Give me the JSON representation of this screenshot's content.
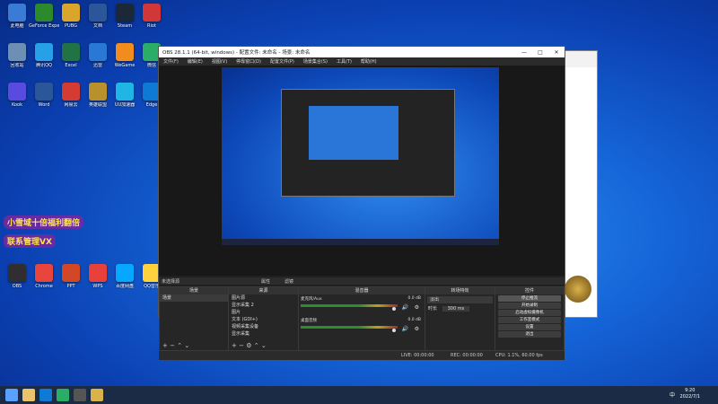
{
  "desktop": {
    "icons": [
      {
        "label": "此电脑",
        "color": "#3a7bd5"
      },
      {
        "label": "GeForce Experience",
        "color": "#2c8a2c"
      },
      {
        "label": "PUBG",
        "color": "#d9a52b"
      },
      {
        "label": "文档",
        "color": "#2b579a"
      },
      {
        "label": "Steam",
        "color": "#1b2838"
      },
      {
        "label": "Riot",
        "color": "#d13639"
      },
      {
        "label": "回收站",
        "color": "#6d8fb3"
      },
      {
        "label": "腾讯QQ",
        "color": "#26a0e6"
      },
      {
        "label": "Excel",
        "color": "#217346"
      },
      {
        "label": "迅雷",
        "color": "#2a78d6"
      },
      {
        "label": "WeGame",
        "color": "#f28c1d"
      },
      {
        "label": "微信",
        "color": "#2aae67"
      },
      {
        "label": "Kook",
        "color": "#5a4be0"
      },
      {
        "label": "Word",
        "color": "#2b579a"
      },
      {
        "label": "网易云",
        "color": "#d43c33"
      },
      {
        "label": "英雄联盟",
        "color": "#b8902c"
      },
      {
        "label": "UU加速器",
        "color": "#1fb5e4"
      },
      {
        "label": "Edge",
        "color": "#0f7ad6"
      },
      {
        "label": "OBS",
        "color": "#302e31"
      },
      {
        "label": "Chrome",
        "color": "#e8453c"
      },
      {
        "label": "PPT",
        "color": "#d24726"
      },
      {
        "label": "WPS",
        "color": "#e8413c"
      },
      {
        "label": "百度网盘",
        "color": "#06a7ff"
      },
      {
        "label": "QQ音乐",
        "color": "#ffd23d"
      }
    ],
    "promo": {
      "line1": "小雪域十倍福利翻倍",
      "line2": "联系管理VX"
    }
  },
  "obs": {
    "title": "OBS 28.1.1 (64-bit, windows) - 配置文件: 未命名 - 场景: 未命名",
    "controls": {
      "minimize": "—",
      "maximize": "□",
      "close": "✕"
    },
    "menu": [
      "文件(F)",
      "编辑(E)",
      "视图(V)",
      "停靠窗口(D)",
      "配置文件(P)",
      "场景集合(S)",
      "工具(T)",
      "帮助(H)"
    ],
    "scene_header": "未选择源",
    "toolbar": {
      "properties": "属性",
      "filters": "滤镜"
    },
    "docks": {
      "scenes": {
        "title": "场景",
        "items": [
          "场景"
        ]
      },
      "sources": {
        "title": "来源",
        "items": [
          "图片源",
          "显示采集 2",
          "图片",
          "文本 (GDI+)",
          "视频采集设备",
          "显示采集"
        ]
      },
      "mixer": {
        "title": "混音器",
        "channels": [
          {
            "name": "麦克风/Aux",
            "db": "0.0 dB"
          },
          {
            "name": "桌面音频",
            "db": "0.0 dB"
          }
        ]
      },
      "transitions": {
        "title": "转场特效",
        "type": "淡出",
        "duration_label": "时长",
        "duration": "300 ms"
      },
      "controls": {
        "title": "控件",
        "buttons": [
          "停止推流",
          "开始录制",
          "启动虚拟摄像机",
          "工作室模式",
          "设置",
          "退出"
        ]
      }
    },
    "status": {
      "live": "LIVE: 00:00:00",
      "rec": "REC: 00:00:00",
      "cpu": "CPU: 1.1%, 60.00 fps"
    }
  },
  "taskbar": {
    "time": "9:20",
    "date": "2022/7/1",
    "lang": "中"
  }
}
